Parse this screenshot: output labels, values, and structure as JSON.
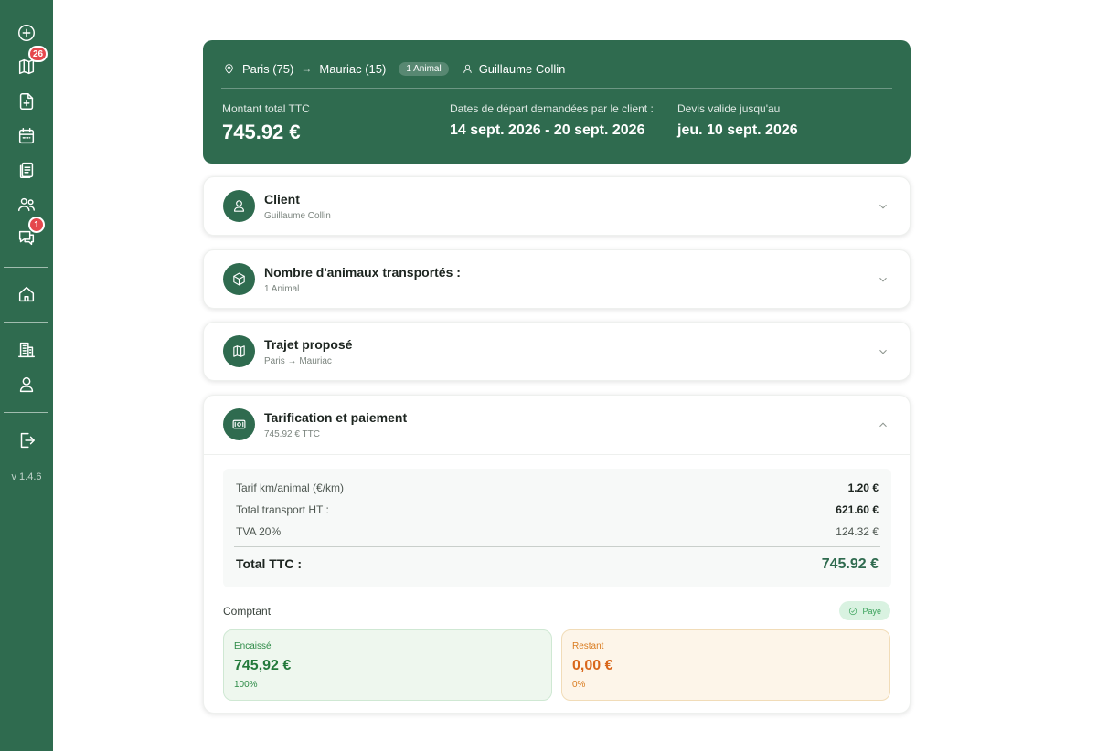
{
  "sidebar": {
    "items": [
      {
        "name": "add-circle-icon"
      },
      {
        "name": "map-icon",
        "badge": "26"
      },
      {
        "name": "file-plus-icon"
      },
      {
        "name": "calendar-icon"
      },
      {
        "name": "documents-icon"
      },
      {
        "name": "users-icon"
      },
      {
        "name": "messages-icon",
        "badge": "1"
      },
      {
        "name": "home-icon"
      },
      {
        "name": "building-icon"
      },
      {
        "name": "user-icon"
      },
      {
        "name": "logout-icon"
      }
    ],
    "version": "v 1.4.6"
  },
  "header": {
    "origin": "Paris (75)",
    "destination": "Mauriac (15)",
    "animal_pill": "1 Animal",
    "client": "Guillaume Collin",
    "total_label": "Montant total TTC",
    "total_value": "745.92 €",
    "dates_label": "Dates de départ demandées par le client :",
    "dates_value": "14 sept. 2026 - 20 sept. 2026",
    "valid_label": "Devis valide jusqu'au",
    "valid_value": "jeu. 10 sept. 2026"
  },
  "sections": {
    "client": {
      "title": "Client",
      "subtitle": "Guillaume Collin"
    },
    "animals": {
      "title": "Nombre d'animaux transportés :",
      "subtitle": "1 Animal"
    },
    "route": {
      "title": "Trajet proposé",
      "subtitle": "Paris → Mauriac"
    },
    "pricing": {
      "title": "Tarification et paiement",
      "subtitle": "745.92 € TTC"
    }
  },
  "pricing": {
    "rows": [
      {
        "label": "Tarif km/animal (€/km)",
        "value": "1.20 €"
      },
      {
        "label": "Total transport HT :",
        "value": "621.60 €"
      },
      {
        "label": "TVA 20%",
        "value": "124.32 €"
      }
    ],
    "total_label": "Total TTC :",
    "total_value": "745.92 €",
    "payment_mode": "Comptant",
    "status": "Payé",
    "collected": {
      "label": "Encaissé",
      "value": "745,92 €",
      "percent": "100%"
    },
    "remaining": {
      "label": "Restant",
      "value": "0,00 €",
      "percent": "0%"
    }
  },
  "colors": {
    "brand": "#2f6b4f",
    "badge": "#e5484d",
    "collected": "#237a3b",
    "remaining": "#d9661a"
  }
}
